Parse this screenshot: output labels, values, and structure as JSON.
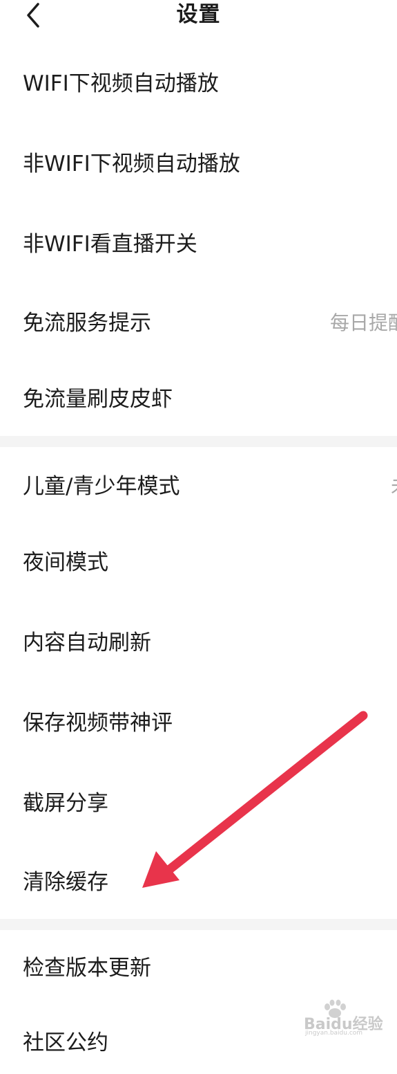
{
  "header": {
    "title": "设置",
    "back_icon": "chevron-left-icon"
  },
  "settings": [
    {
      "label": "WIFI下视频自动播放",
      "value": ""
    },
    {
      "label": "非WIFI下视频自动播放",
      "value": ""
    },
    {
      "label": "非WIFI看直播开关",
      "value": ""
    },
    {
      "label": "免流服务提示",
      "value": "每日提醒"
    },
    {
      "label": "免流量刷皮皮虾",
      "value": ""
    },
    {
      "label": "儿童/青少年模式",
      "value": "未"
    },
    {
      "label": "夜间模式",
      "value": ""
    },
    {
      "label": "内容自动刷新",
      "value": ""
    },
    {
      "label": "保存视频带神评",
      "value": ""
    },
    {
      "label": "截屏分享",
      "value": ""
    },
    {
      "label": "清除缓存",
      "value": ""
    },
    {
      "label": "检查版本更新",
      "value": ""
    },
    {
      "label": "社区公约",
      "value": ""
    }
  ],
  "annotation": {
    "color": "#e8344b",
    "icon": "red-arrow-pointing-to-clear-cache"
  },
  "watermark": {
    "text": "Baidu经验",
    "subtext": "jingyan.baidu.com",
    "icon": "baidu-paw-icon"
  }
}
